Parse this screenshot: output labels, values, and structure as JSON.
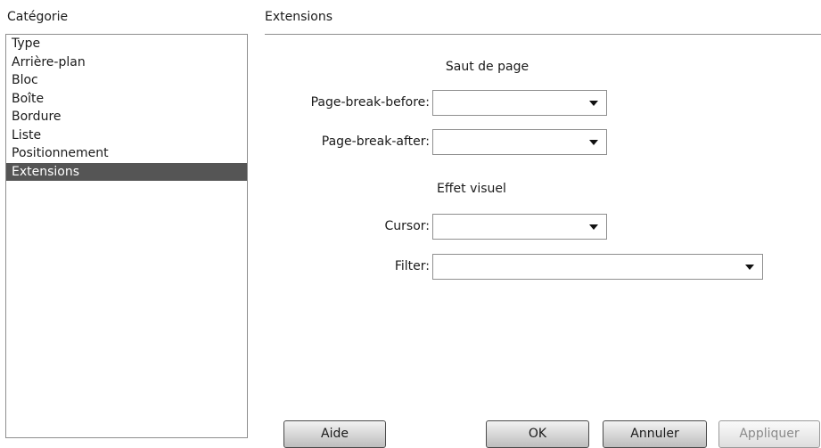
{
  "category": {
    "label": "Catégorie",
    "items": [
      "Type",
      "Arrière-plan",
      "Bloc",
      "Boîte",
      "Bordure",
      "Liste",
      "Positionnement",
      "Extensions"
    ],
    "selected": "Extensions"
  },
  "panel": {
    "title": "Extensions",
    "page_break": {
      "heading": "Saut de page",
      "before_label": "Page-break-before:",
      "before_value": "",
      "after_label": "Page-break-after:",
      "after_value": ""
    },
    "visual_effect": {
      "heading": "Effet visuel",
      "cursor_label": "Cursor:",
      "cursor_value": "",
      "filter_label": "Filter:",
      "filter_value": ""
    }
  },
  "buttons": {
    "help": "Aide",
    "ok": "OK",
    "cancel": "Annuler",
    "apply": "Appliquer",
    "apply_enabled": false
  }
}
